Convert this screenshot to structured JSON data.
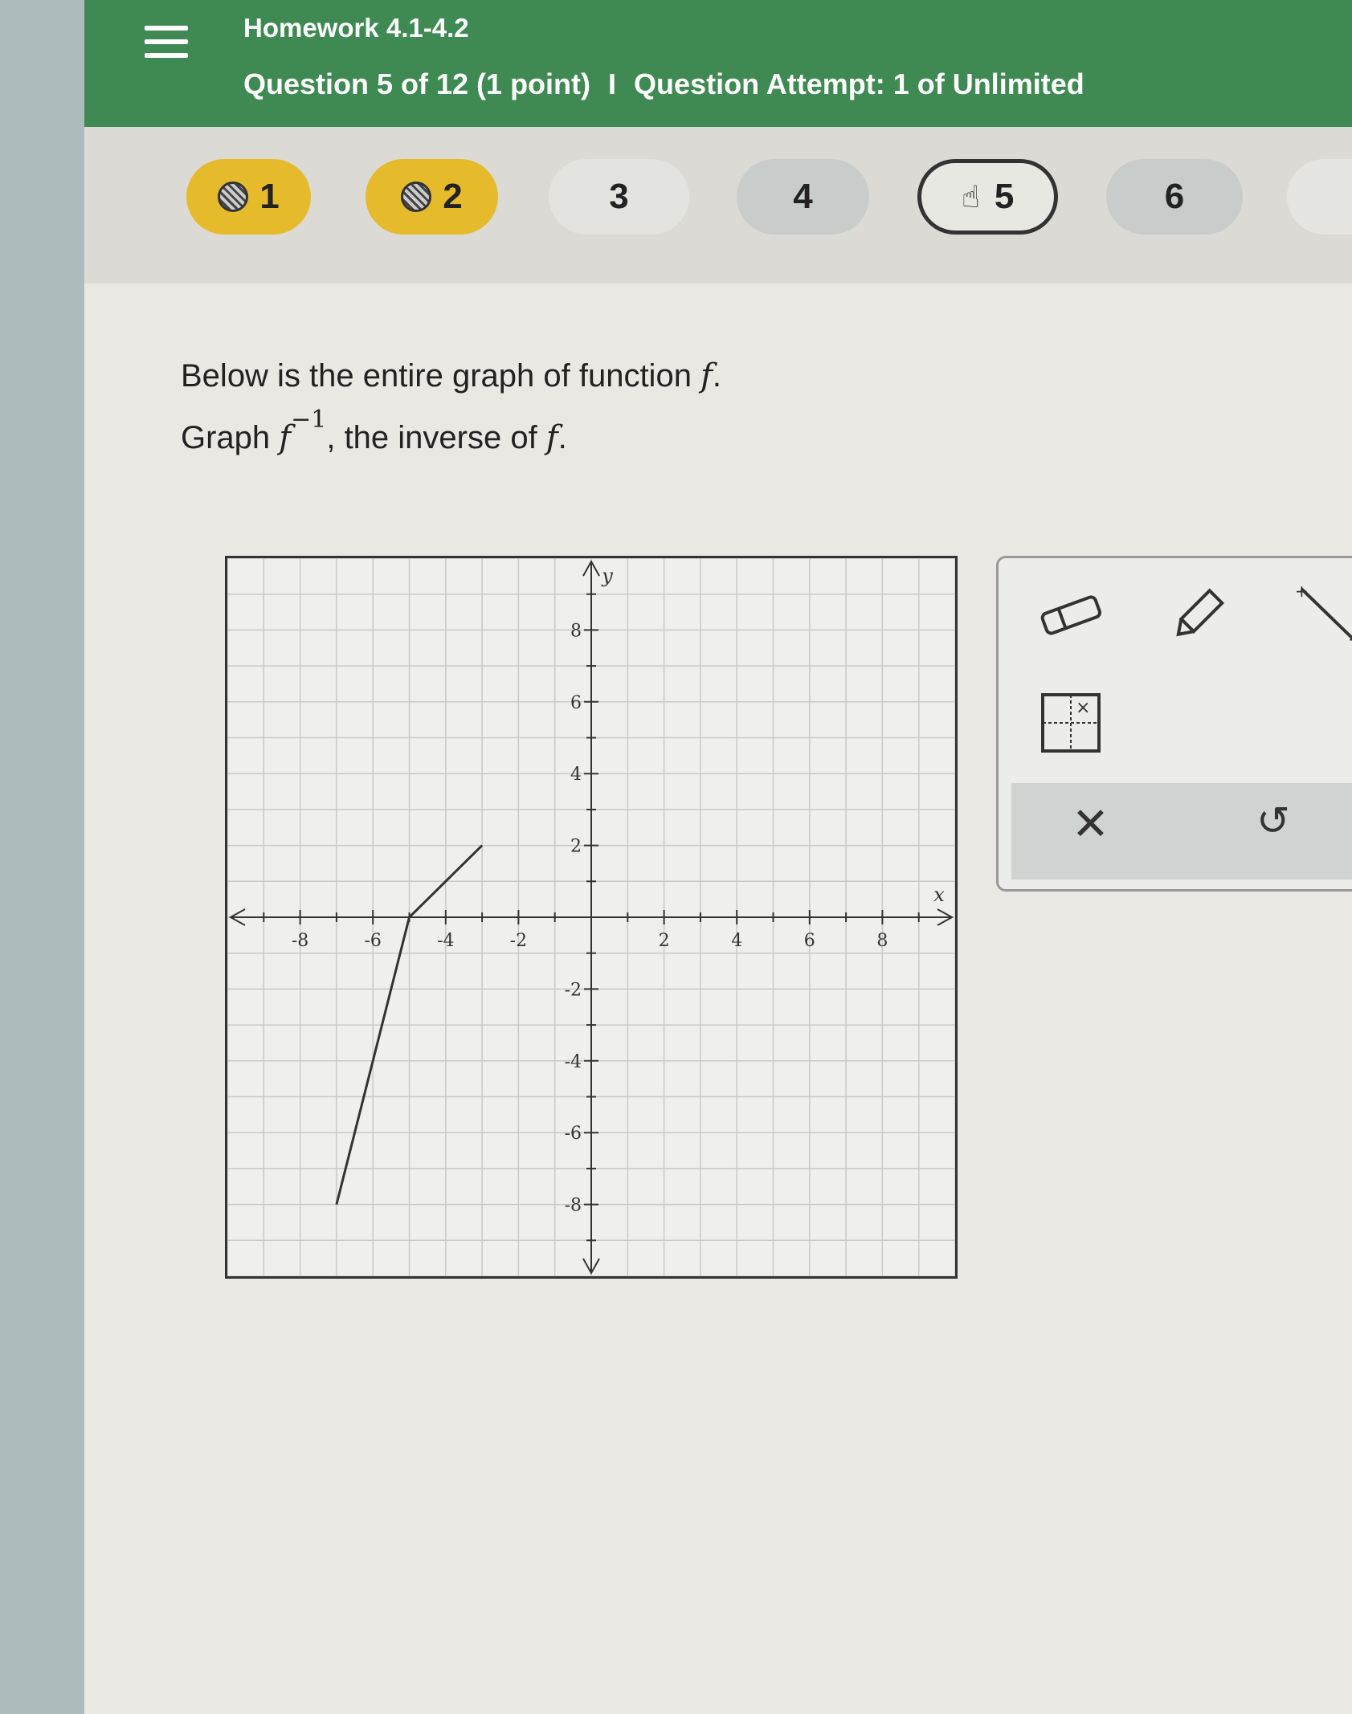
{
  "header": {
    "title": "Homework 4.1-4.2",
    "question_label": "Question 5 of 12 (1 point)",
    "separator": "I",
    "attempt_label": "Question Attempt: 1 of Unlimited"
  },
  "question_nav": {
    "items": [
      {
        "label": "1",
        "state": "done"
      },
      {
        "label": "2",
        "state": "done"
      },
      {
        "label": "3",
        "state": "plain"
      },
      {
        "label": "4",
        "state": "default"
      },
      {
        "label": "5",
        "state": "current"
      },
      {
        "label": "6",
        "state": "default"
      }
    ]
  },
  "prompt": {
    "line1_text": "Below is the entire graph of function ",
    "line1_var": "f",
    "line1_end": ".",
    "line2_text": "Graph ",
    "line2_var": "f",
    "line2_sup": "−1",
    "line2_mid": ", the inverse of ",
    "line2_var2": "f",
    "line2_end": "."
  },
  "graph": {
    "x_axis_label": "x",
    "y_axis_label": "y",
    "x_range": [
      -10,
      10
    ],
    "y_range": [
      -10,
      10
    ],
    "x_ticks": [
      "-8",
      "-6",
      "-4",
      "-2",
      "2",
      "4",
      "6",
      "8"
    ],
    "y_ticks": [
      "8",
      "6",
      "4",
      "2",
      "-2",
      "-4",
      "-6",
      "-8"
    ],
    "function_points": [
      [
        -7,
        -8
      ],
      [
        -5,
        0
      ],
      [
        -3,
        2
      ]
    ]
  },
  "tools": {
    "eraser": "eraser-icon",
    "pencil": "pencil-icon",
    "line": "line-segment-icon",
    "point": "point-grid-icon",
    "clear_symbol": "✕",
    "undo_symbol": "↺"
  },
  "colors": {
    "header_bg": "#3f8a52",
    "done_pill": "#e5bb2c",
    "grid_line": "#c9c9c6",
    "graph_line": "#333333"
  }
}
